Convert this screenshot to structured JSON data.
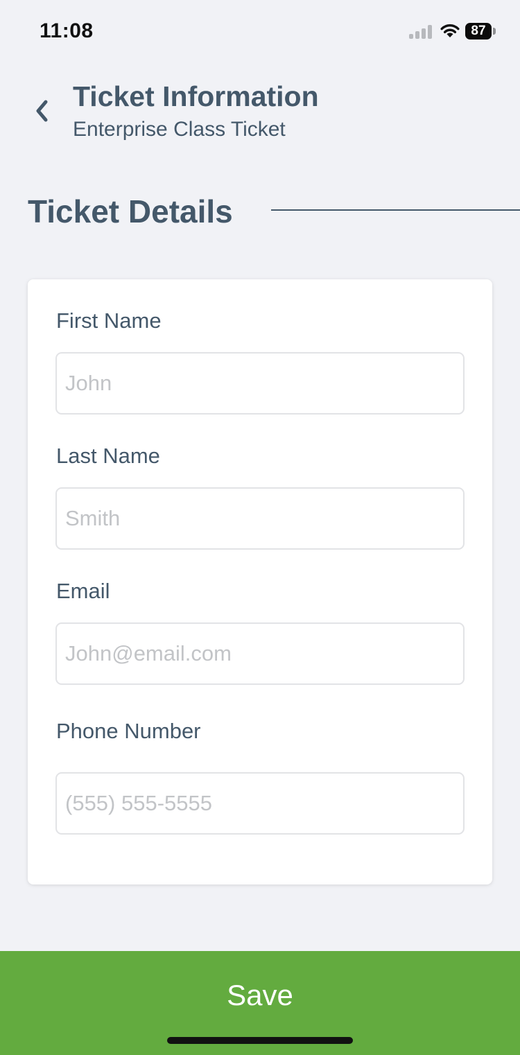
{
  "status_bar": {
    "time": "11:08",
    "battery_level": "87"
  },
  "header": {
    "title": "Ticket Information",
    "subtitle": "Enterprise Class Ticket"
  },
  "section": {
    "title": "Ticket Details"
  },
  "form": {
    "first_name": {
      "label": "First Name",
      "placeholder": "John",
      "value": ""
    },
    "last_name": {
      "label": "Last Name",
      "placeholder": "Smith",
      "value": ""
    },
    "email": {
      "label": "Email",
      "placeholder": "John@email.com",
      "value": ""
    },
    "phone": {
      "label": "Phone Number",
      "placeholder": "(555) 555-5555",
      "value": ""
    }
  },
  "actions": {
    "save_label": "Save"
  },
  "colors": {
    "background": "#f1f2f6",
    "text": "#44586a",
    "accent_green": "#63ab3f",
    "card": "#ffffff",
    "input_border": "#e2e3e6",
    "placeholder": "#c2c4c7"
  },
  "icons": {
    "back": "chevron-left-icon",
    "signal": "cellular-signal-icon",
    "wifi": "wifi-icon",
    "battery": "battery-icon"
  }
}
